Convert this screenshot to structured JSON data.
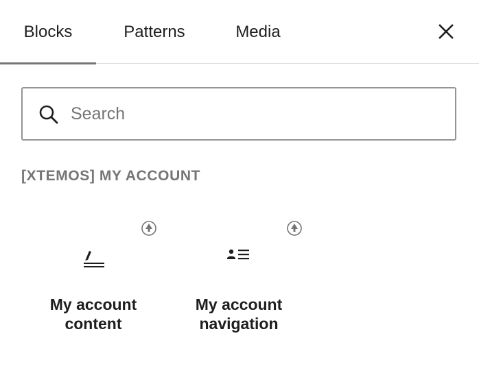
{
  "tabs": [
    {
      "label": "Blocks",
      "active": true
    },
    {
      "label": "Patterns",
      "active": false
    },
    {
      "label": "Media",
      "active": false
    }
  ],
  "close": {
    "icon": "close-icon"
  },
  "search": {
    "placeholder": "Search",
    "value": "",
    "icon": "search-icon"
  },
  "category": {
    "title": "[XTEMOS] MY ACCOUNT",
    "blocks": [
      {
        "label_line1": "My account",
        "label_line2": "content",
        "icon": "signature-pen-icon",
        "badge_icon": "tree-badge-icon"
      },
      {
        "label_line1": "My account",
        "label_line2": "navigation",
        "icon": "person-list-icon",
        "badge_icon": "tree-badge-icon"
      }
    ]
  },
  "colors": {
    "text": "#1e1e1e",
    "muted": "#757575",
    "border": "#949494",
    "divider": "#dddddd"
  }
}
